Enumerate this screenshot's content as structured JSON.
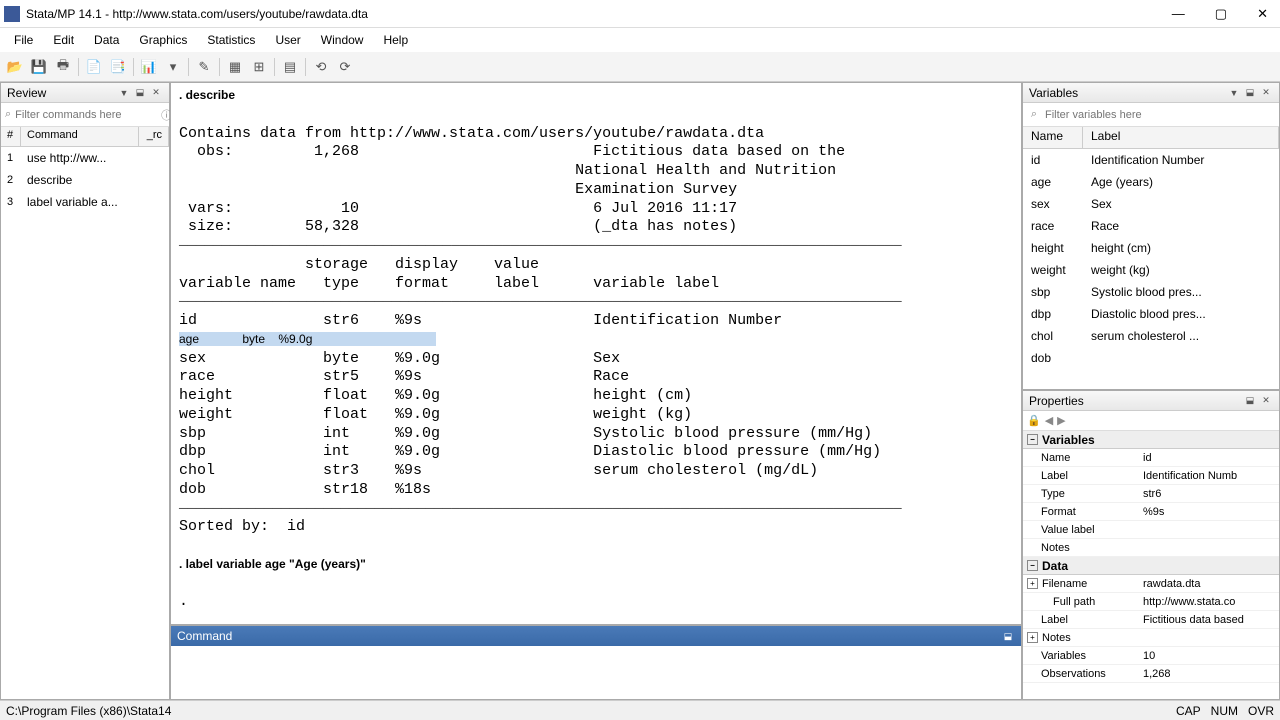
{
  "title": "Stata/MP 14.1 - http://www.stata.com/users/youtube/rawdata.dta",
  "menu": [
    "File",
    "Edit",
    "Data",
    "Graphics",
    "Statistics",
    "User",
    "Window",
    "Help"
  ],
  "review": {
    "title": "Review",
    "filter_placeholder": "Filter commands here",
    "cols": {
      "num": "#",
      "cmd": "Command",
      "rc": "_rc"
    },
    "items": [
      {
        "n": "1",
        "cmd": "use http://ww..."
      },
      {
        "n": "2",
        "cmd": "describe"
      },
      {
        "n": "3",
        "cmd": "label variable a..."
      }
    ]
  },
  "results": {
    "cmd1": ". describe",
    "contains": "Contains data from http://www.stata.com/users/youtube/rawdata.dta",
    "obs_label": "  obs:",
    "obs_val": "         1,268",
    "obs_note1": "                          Fictitious data based on the",
    "obs_note2": "                                            National Health and Nutrition",
    "obs_note3": "                                            Examination Survey",
    "vars_label": " vars:",
    "vars_val": "            10",
    "vars_date": "                          6 Jul 2016 11:17",
    "size_label": " size:",
    "size_val": "        58,328",
    "size_note": "                          (_dta has notes)",
    "hdr1": "              storage   display    value",
    "hdr2": "variable name   type    format     label      variable label",
    "rows": [
      {
        "line": "id              str6    %9s                   Identification Number",
        "hl": false
      },
      {
        "line": "age             byte    %9.0g                 ",
        "hl": true
      },
      {
        "line": "sex             byte    %9.0g                 Sex",
        "hl": false
      },
      {
        "line": "race            str5    %9s                   Race",
        "hl": false
      },
      {
        "line": "height          float   %9.0g                 height (cm)",
        "hl": false
      },
      {
        "line": "weight          float   %9.0g                 weight (kg)",
        "hl": false
      },
      {
        "line": "sbp             int     %9.0g                 Systolic blood pressure (mm/Hg)",
        "hl": false
      },
      {
        "line": "dbp             int     %9.0g                 Diastolic blood pressure (mm/Hg)",
        "hl": false
      },
      {
        "line": "chol            str3    %9s                   serum cholesterol (mg/dL)",
        "hl": false
      },
      {
        "line": "dob             str18   %18s                  ",
        "hl": false
      }
    ],
    "sorted": "Sorted by:  id",
    "cmd2": ". label variable age \"Age (years)\"",
    "prompt": ". "
  },
  "command_title": "Command",
  "variables": {
    "title": "Variables",
    "filter_placeholder": "Filter variables here",
    "cols": {
      "name": "Name",
      "label": "Label"
    },
    "items": [
      {
        "name": "id",
        "label": "Identification Number"
      },
      {
        "name": "age",
        "label": "Age (years)"
      },
      {
        "name": "sex",
        "label": "Sex"
      },
      {
        "name": "race",
        "label": "Race"
      },
      {
        "name": "height",
        "label": "height (cm)"
      },
      {
        "name": "weight",
        "label": "weight (kg)"
      },
      {
        "name": "sbp",
        "label": "Systolic blood pres..."
      },
      {
        "name": "dbp",
        "label": "Diastolic blood pres..."
      },
      {
        "name": "chol",
        "label": "serum cholesterol ..."
      },
      {
        "name": "dob",
        "label": ""
      }
    ]
  },
  "properties": {
    "title": "Properties",
    "vars_section": "Variables",
    "data_section": "Data",
    "var_rows": [
      {
        "name": "Name",
        "val": "id"
      },
      {
        "name": "Label",
        "val": "Identification Numb"
      },
      {
        "name": "Type",
        "val": "str6"
      },
      {
        "name": "Format",
        "val": "%9s"
      },
      {
        "name": "Value label",
        "val": ""
      },
      {
        "name": "Notes",
        "val": ""
      }
    ],
    "data_rows": [
      {
        "name": "Filename",
        "val": "rawdata.dta",
        "collapsible": true
      },
      {
        "name": "Full path",
        "val": "http://www.stata.co",
        "indent": true
      },
      {
        "name": "Label",
        "val": "Fictitious data based"
      },
      {
        "name": "Notes",
        "val": "",
        "collapsible": true
      },
      {
        "name": "Variables",
        "val": "10"
      },
      {
        "name": "Observations",
        "val": "1,268"
      }
    ]
  },
  "statusbar": {
    "path": "C:\\Program Files (x86)\\Stata14",
    "indicators": [
      "CAP",
      "NUM",
      "OVR"
    ]
  }
}
